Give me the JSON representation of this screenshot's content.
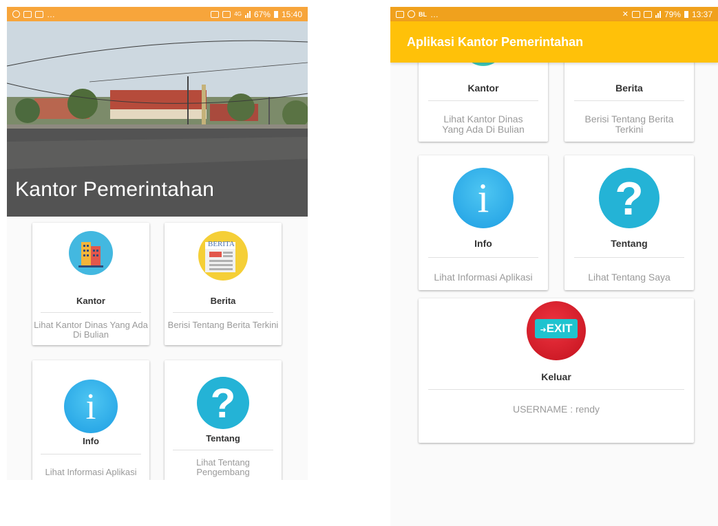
{
  "left_screen": {
    "statusbar": {
      "battery": "67%",
      "time": "15:40",
      "network": "4G"
    },
    "hero_title": "Kantor Pemerintahan",
    "cards": [
      {
        "label": "Kantor",
        "desc": "Lihat Kantor Dinas Yang Ada Di Bulian",
        "icon": "office-building-icon"
      },
      {
        "label": "Berita",
        "desc": "Berisi Tentang Berita Terkini",
        "icon": "newspaper-icon",
        "icon_text": "BERITA"
      },
      {
        "label": "Info",
        "desc": "Lihat Informasi Aplikasi",
        "icon": "info-icon"
      },
      {
        "label": "Tentang",
        "desc": "Lihat Tentang Pengembang",
        "icon": "question-icon"
      }
    ]
  },
  "right_screen": {
    "statusbar": {
      "battery": "79%",
      "time": "13:37",
      "network": "BL"
    },
    "appbar_title": "Aplikasi Kantor Pemerintahan",
    "cards": [
      {
        "label": "Kantor",
        "desc": "Lihat Kantor Dinas Yang Ada Di Bulian"
      },
      {
        "label": "Berita",
        "desc": "Berisi Tentang Berita Terkini"
      },
      {
        "label": "Info",
        "desc": "Lihat Informasi Aplikasi",
        "icon": "info-icon"
      },
      {
        "label": "Tentang",
        "desc": "Lihat Tentang Saya",
        "icon": "question-icon"
      },
      {
        "label": "Keluar",
        "desc": "USERNAME : rendy",
        "icon": "exit-icon",
        "icon_text": "EXIT"
      }
    ]
  },
  "colors": {
    "appbar": "#ffc109",
    "statusbar": "#f0a11d",
    "info_icon": "#29a9e8",
    "question_icon": "#24b3d6",
    "exit_icon": "#d9202c"
  },
  "glyphs": {
    "info": "i",
    "question": "?"
  }
}
